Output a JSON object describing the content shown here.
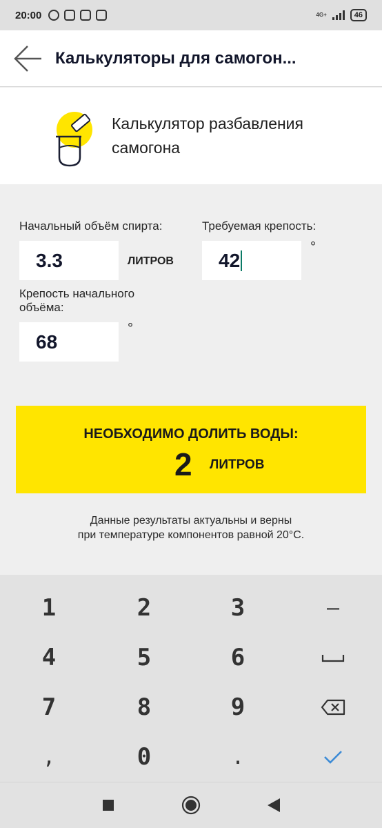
{
  "status_bar": {
    "time": "20:00",
    "network": "4G+",
    "battery": "46"
  },
  "header": {
    "title": "Калькуляторы для самогон..."
  },
  "calculator": {
    "title": "Калькулятор разбавления самогона"
  },
  "form": {
    "initial_volume": {
      "label": "Начальный объём спирта:",
      "value": "3.3",
      "unit": "ЛИТРОВ"
    },
    "target_strength": {
      "label": "Требуемая крепость:",
      "value": "42",
      "unit": "°"
    },
    "initial_strength": {
      "label": "Крепость начального объёма:",
      "value": "68",
      "unit": "°"
    }
  },
  "result": {
    "title": "НЕОБХОДИМО ДОЛИТЬ ВОДЫ:",
    "value": "2",
    "unit": "ЛИТРОВ"
  },
  "note": {
    "line1": "Данные результаты актуальны и верны",
    "line2": "при температуре компонентов равной 20°C."
  },
  "keyboard": {
    "keys": [
      "1",
      "2",
      "3",
      "–",
      "4",
      "5",
      "6",
      "space",
      "7",
      "8",
      "9",
      "backspace",
      ",",
      "0",
      ".",
      "done"
    ]
  },
  "colors": {
    "accent_yellow": "#ffe500",
    "header_text": "#12162b",
    "caret": "#0b7a66",
    "done_check": "#3d8bd6"
  },
  "icons": {
    "back": "arrow-left-icon",
    "calculator": "flask-pour-icon",
    "space": "space-bar-icon",
    "backspace": "backspace-icon",
    "done": "checkmark-icon",
    "nav_recent": "square-icon",
    "nav_home": "circle-icon",
    "nav_back": "triangle-icon"
  }
}
